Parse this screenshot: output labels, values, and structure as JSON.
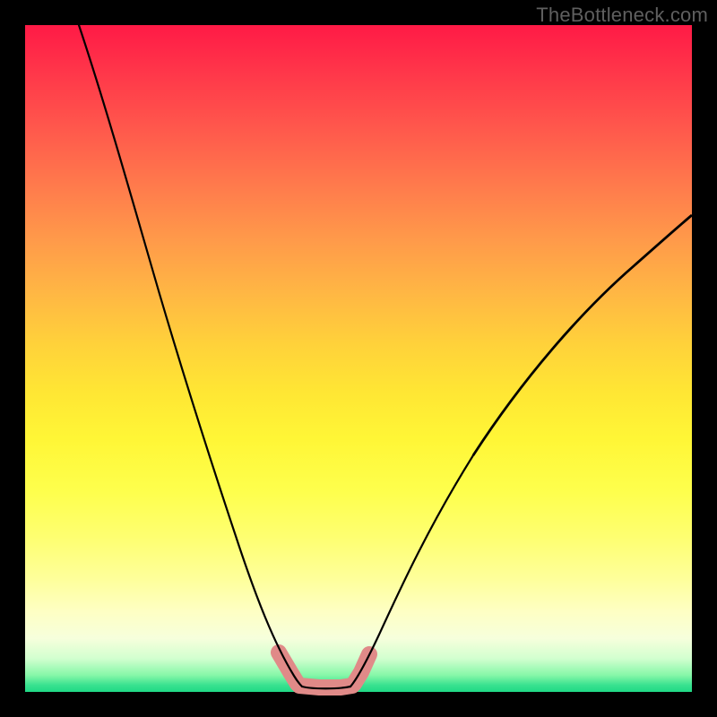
{
  "watermark": "TheBottleneck.com",
  "colors": {
    "frame": "#000000",
    "curve": "#000000",
    "accent": "#e08a88"
  },
  "chart_data": {
    "type": "line",
    "title": "",
    "xlabel": "",
    "ylabel": "",
    "xlim": [
      0,
      100
    ],
    "ylim": [
      0,
      100
    ],
    "grid": false,
    "legend": false,
    "background": "rainbow-gradient-red-to-green",
    "series": [
      {
        "name": "left-branch",
        "x": [
          8,
          12,
          16,
          20,
          24,
          28,
          32,
          36,
          38,
          40,
          41
        ],
        "y": [
          100,
          85,
          70,
          56,
          42,
          29,
          18,
          9,
          5,
          2,
          0.5
        ]
      },
      {
        "name": "bottom-flat",
        "x": [
          41,
          44,
          47,
          49
        ],
        "y": [
          0.5,
          0.3,
          0.3,
          0.5
        ]
      },
      {
        "name": "right-branch",
        "x": [
          49,
          52,
          56,
          62,
          70,
          80,
          90,
          100
        ],
        "y": [
          0.5,
          4,
          10,
          20,
          33,
          48,
          61,
          72
        ]
      }
    ],
    "accent_segments": [
      {
        "name": "left-near-bottom",
        "x": [
          38.5,
          41
        ],
        "y": [
          4,
          0.7
        ]
      },
      {
        "name": "bottom",
        "x": [
          41,
          49
        ],
        "y": [
          0.7,
          0.7
        ]
      },
      {
        "name": "right-near-bottom",
        "x": [
          49,
          51.5
        ],
        "y": [
          0.7,
          4
        ]
      }
    ]
  }
}
